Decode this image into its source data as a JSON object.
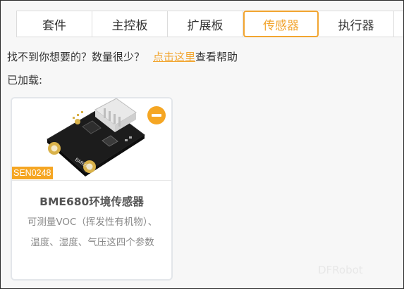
{
  "tabs": [
    {
      "label": "套件",
      "active": false
    },
    {
      "label": "主控板",
      "active": false
    },
    {
      "label": "扩展板",
      "active": false
    },
    {
      "label": "传感器",
      "active": true
    },
    {
      "label": "执行器",
      "active": false
    }
  ],
  "help": {
    "text": "找不到你想要的？数量很少？",
    "link": "点击这里",
    "suffix": "查看帮助"
  },
  "loaded_label": "已加载:",
  "card": {
    "sku": "SEN0248",
    "board_label": "BME680",
    "title": "BME680环境传感器",
    "description": "可测量VOC（挥发性有机物）、温度、湿度、气压这四个参数",
    "remove_icon": "minus-circle-icon"
  },
  "watermark": "DFRobot",
  "colors": {
    "accent": "#f2a530",
    "badge": "#f5a623"
  }
}
